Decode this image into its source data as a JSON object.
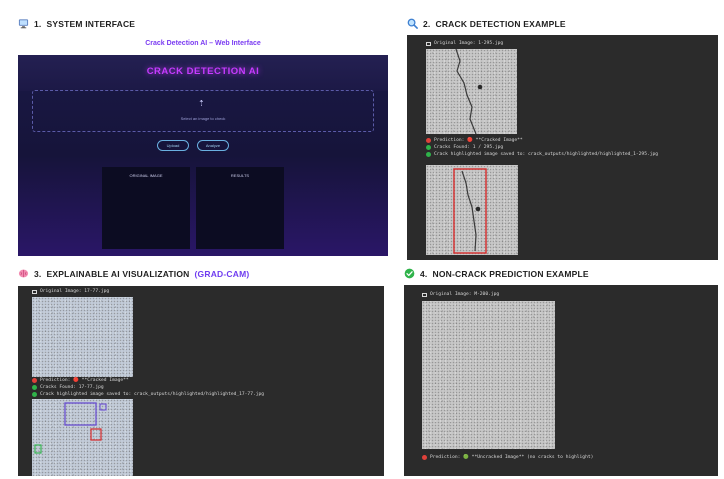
{
  "colors": {
    "accent": "#6f3cf0",
    "web_title": "#c63bff",
    "console_bg": "#2b2b2b",
    "status_red": "#e0413a",
    "status_green": "#2fb34a",
    "box_red": "#d62b2b",
    "box_blue": "#6a4fd0"
  },
  "icons": {
    "system": "computer-monitor-icon",
    "detection": "magnifier-icon",
    "xai": "brain-icon",
    "noncrack": "green-check-icon"
  },
  "sections": {
    "system": {
      "number": "1.",
      "title": "SYSTEM INTERFACE"
    },
    "detection": {
      "number": "2.",
      "title": "CRACK DETECTION EXAMPLE"
    },
    "xai": {
      "number": "3.",
      "title": "EXPLAINABLE AI VISUALIZATION",
      "accent": "(GRAD-CAM)"
    },
    "noncrack": {
      "number": "4.",
      "title": "NON-CRACK PREDICTION EXAMPLE"
    }
  },
  "web": {
    "heading": "Crack Detection AI – Web Interface",
    "app_title": "CRACK DETECTION AI",
    "upload_text": "Select an image to check",
    "buttons": [
      "Upload",
      "Analyze"
    ],
    "panels": [
      "ORIGINAL IMAGE",
      "RESULTS"
    ]
  },
  "detection": {
    "lines": [
      "Original Image: 1-295.jpg",
      "Prediction: 🔴 **Cracked Image**",
      "Cracks Found: 1 / 295.jpg",
      "Crack highlighted image saved to: crack_outputs/highlighted/highlighted_1-295.jpg"
    ]
  },
  "xai": {
    "lines": [
      "Original Image: 17-77.jpg",
      "Prediction: 🔴 **Cracked Image**",
      "Cracks Found: 17-77.jpg",
      "Crack highlighted image saved to: crack_outputs/highlighted/highlighted_17-77.jpg"
    ]
  },
  "noncrack": {
    "lines": [
      "Original Image: M-200.jpg",
      "Prediction: 🟢 **Uncracked Image** (no cracks to highlight)"
    ]
  }
}
